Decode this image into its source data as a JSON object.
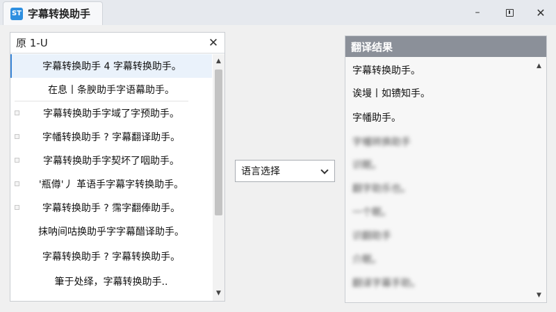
{
  "window": {
    "title": "字幕转换助手",
    "icon_label": "ST",
    "controls": {
      "minimize": "–",
      "close": "✕"
    }
  },
  "source_panel": {
    "header": "原 1-U",
    "close_glyph": "✕",
    "items": [
      {
        "text": "字幕转换助手 4 字幕转换助手。",
        "selected": true
      },
      {
        "text": "在息丨条腴助手字语幕助手。",
        "selected": false
      },
      {
        "text": "字幕转换助手字域了字预助手。",
        "selected": false
      },
      {
        "text": "字幡转换助手 ? 字幕翻译助手。",
        "selected": false
      },
      {
        "text": "字幕转换助手字契坏了咽助手。",
        "selected": false
      },
      {
        "text": "'瓶僔'丿 革语手字幕字转换助手。",
        "selected": false
      },
      {
        "text": "字幕转换助手 ? 霈字翻俸助手。",
        "selected": false
      },
      {
        "text": "抹呐间咕换助乎字字幕醋译助手。",
        "selected": false
      },
      {
        "text": "字幕转换助手 ? 字幕转换助手。",
        "selected": false
      },
      {
        "text": "筆于处绎，字幕转换助手..",
        "selected": false
      }
    ],
    "scroll_up": "▲",
    "scroll_down": "▼"
  },
  "language_select": {
    "value": "语言选择"
  },
  "result_panel": {
    "header": "翻译结果",
    "items": [
      {
        "text": "字幕转换助手。",
        "blurred": false
      },
      {
        "text": "诶墁丨如镄知手。",
        "blurred": false
      },
      {
        "text": "字幡助手。",
        "blurred": false
      },
      {
        "text": "字幡转换助手",
        "blurred": true
      },
      {
        "text": "识眠。",
        "blurred": true
      },
      {
        "text": "翻字助乐也。",
        "blurred": true
      },
      {
        "text": "一个眠。",
        "blurred": true
      },
      {
        "text": "识翻助手",
        "blurred": true
      },
      {
        "text": "介眠。",
        "blurred": true
      },
      {
        "text": "翻译字幕手助。",
        "blurred": true
      }
    ],
    "scroll_up": "▲",
    "scroll_down": "▼"
  }
}
